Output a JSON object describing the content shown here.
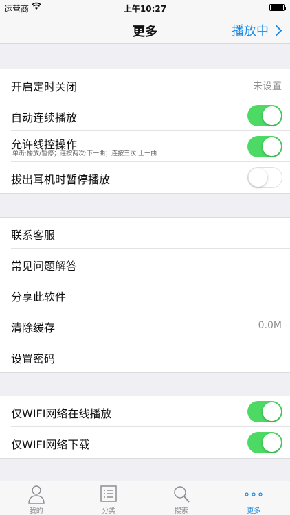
{
  "status_bar": {
    "carrier": "运营商",
    "time": "上午10:27"
  },
  "nav": {
    "title": "更多",
    "right_label": "播放中"
  },
  "group1": [
    {
      "label": "开启定时关闭",
      "value": "未设置"
    },
    {
      "label": "自动连续播放",
      "toggle": true
    },
    {
      "label": "允许线控操作",
      "toggle": true,
      "sub": "单击:播放/暂停；连按两次:下一曲；连按三次:上一曲"
    },
    {
      "label": "拔出耳机时暂停播放",
      "toggle": false
    }
  ],
  "group2": [
    {
      "label": "联系客服"
    },
    {
      "label": "常见问题解答"
    },
    {
      "label": "分享此软件"
    },
    {
      "label": "清除缓存",
      "value": "0.0M"
    },
    {
      "label": "设置密码"
    }
  ],
  "group3": [
    {
      "label": "仅WIFI网络在线播放",
      "toggle": true
    },
    {
      "label": "仅WIFI网络下载",
      "toggle": true
    }
  ],
  "tabs": [
    {
      "label": "我的",
      "icon": "person-icon"
    },
    {
      "label": "分类",
      "icon": "list-icon"
    },
    {
      "label": "搜索",
      "icon": "search-icon"
    },
    {
      "label": "更多",
      "icon": "more-dots-icon",
      "active": true
    }
  ],
  "colors": {
    "accent": "#1b8de8",
    "toggle_on": "#4cd964"
  }
}
